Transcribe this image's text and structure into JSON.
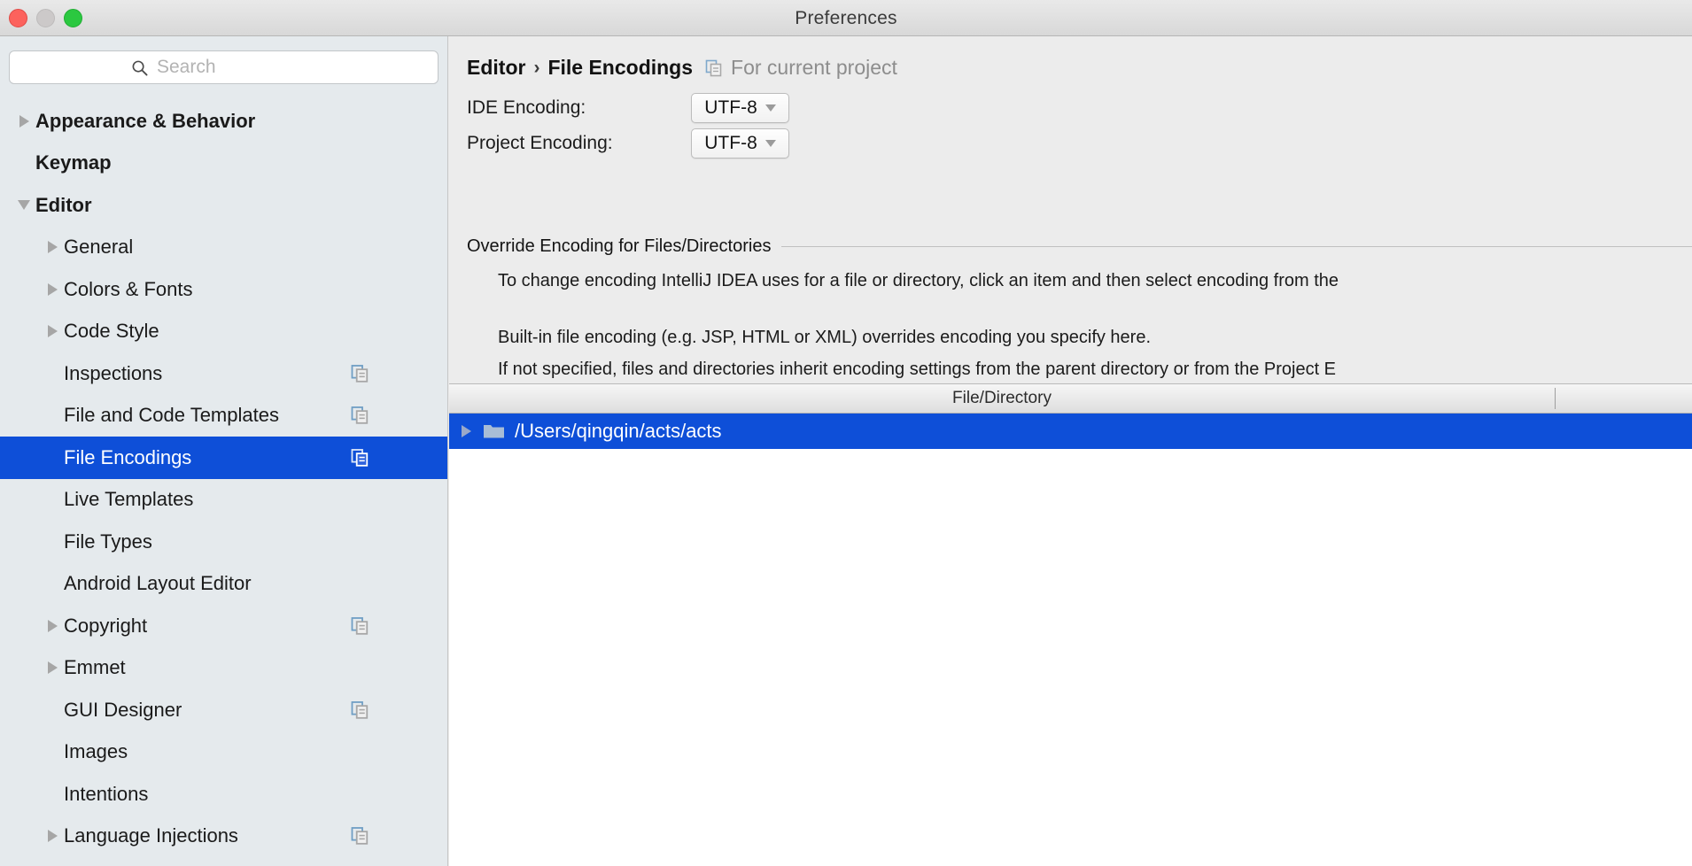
{
  "window": {
    "title": "Preferences"
  },
  "traffic": {
    "close": "close-button",
    "minimize": "minimize-button",
    "zoom": "zoom-button"
  },
  "search": {
    "placeholder": "Search",
    "value": ""
  },
  "sidebar": {
    "items": [
      {
        "label": "Appearance & Behavior",
        "level": 0,
        "bold": true,
        "arrow": "right",
        "copy": false
      },
      {
        "label": "Keymap",
        "level": 0,
        "bold": true,
        "arrow": "none",
        "copy": false
      },
      {
        "label": "Editor",
        "level": 0,
        "bold": true,
        "arrow": "down",
        "copy": false
      },
      {
        "label": "General",
        "level": 1,
        "bold": false,
        "arrow": "right",
        "copy": false
      },
      {
        "label": "Colors & Fonts",
        "level": 1,
        "bold": false,
        "arrow": "right",
        "copy": false
      },
      {
        "label": "Code Style",
        "level": 1,
        "bold": false,
        "arrow": "right",
        "copy": false
      },
      {
        "label": "Inspections",
        "level": 1,
        "bold": false,
        "arrow": "none",
        "copy": true
      },
      {
        "label": "File and Code Templates",
        "level": 1,
        "bold": false,
        "arrow": "none",
        "copy": true
      },
      {
        "label": "File Encodings",
        "level": 1,
        "bold": false,
        "arrow": "none",
        "copy": true,
        "selected": true
      },
      {
        "label": "Live Templates",
        "level": 1,
        "bold": false,
        "arrow": "none",
        "copy": false
      },
      {
        "label": "File Types",
        "level": 1,
        "bold": false,
        "arrow": "none",
        "copy": false
      },
      {
        "label": "Android Layout Editor",
        "level": 1,
        "bold": false,
        "arrow": "none",
        "copy": false
      },
      {
        "label": "Copyright",
        "level": 1,
        "bold": false,
        "arrow": "right",
        "copy": true
      },
      {
        "label": "Emmet",
        "level": 1,
        "bold": false,
        "arrow": "right",
        "copy": false
      },
      {
        "label": "GUI Designer",
        "level": 1,
        "bold": false,
        "arrow": "none",
        "copy": true
      },
      {
        "label": "Images",
        "level": 1,
        "bold": false,
        "arrow": "none",
        "copy": false
      },
      {
        "label": "Intentions",
        "level": 1,
        "bold": false,
        "arrow": "none",
        "copy": false
      },
      {
        "label": "Language Injections",
        "level": 1,
        "bold": false,
        "arrow": "right",
        "copy": true
      }
    ]
  },
  "main": {
    "breadcrumb": {
      "parent": "Editor",
      "separator": "›",
      "current": "File Encodings",
      "scope_label": "For current project"
    },
    "ide_encoding": {
      "label": "IDE Encoding:",
      "value": "UTF-8"
    },
    "project_encoding": {
      "label": "Project Encoding:",
      "value": "UTF-8"
    },
    "section_title": "Override Encoding for Files/Directories",
    "description": [
      "To change encoding IntelliJ IDEA uses for a file or directory, click an item and then select encoding from the",
      "",
      "Built-in file encoding (e.g. JSP, HTML or XML) overrides encoding you specify here.",
      "If not specified, files and directories inherit encoding settings from the parent directory or from the Project E"
    ],
    "table": {
      "columns": [
        "File/Directory"
      ],
      "rows": [
        {
          "path": "/Users/qingqin/acts/acts",
          "expanded": false,
          "selected": true
        }
      ]
    }
  },
  "colors": {
    "selection_blue": "#0e4fd8",
    "sidebar_bg": "#e5eaed",
    "panel_bg": "#ececec",
    "titlebar_bg": "#e0e0e0"
  }
}
